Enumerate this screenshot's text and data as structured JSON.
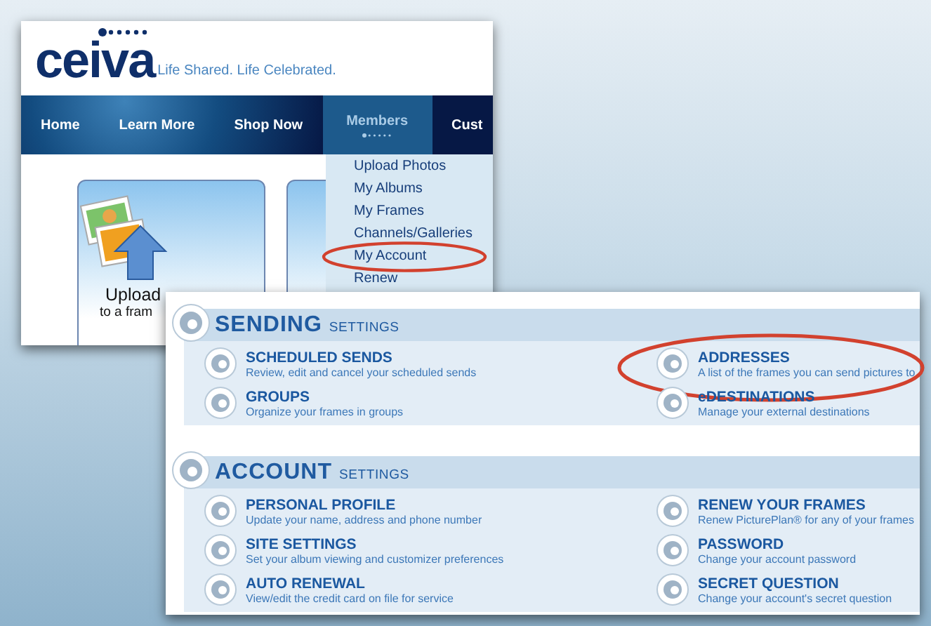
{
  "site": {
    "logo": "ceiva",
    "tagline": "Life Shared.  Life Celebrated."
  },
  "nav": [
    {
      "label": "Home",
      "selected": false
    },
    {
      "label": "Learn More",
      "selected": false
    },
    {
      "label": "Shop Now",
      "selected": false
    },
    {
      "label": "Members",
      "selected": true
    },
    {
      "label": "Cust",
      "selected": false
    }
  ],
  "dropdown": [
    {
      "label": "Upload Photos",
      "circled": false
    },
    {
      "label": "My Albums",
      "circled": false
    },
    {
      "label": "My Frames",
      "circled": false
    },
    {
      "label": "Channels/Galleries",
      "circled": false
    },
    {
      "label": "My Account",
      "circled": true
    },
    {
      "label": "Renew",
      "circled": false
    }
  ],
  "card": {
    "title": "Upload",
    "subtitle": "to a fram"
  },
  "sections": [
    {
      "title": "SENDING",
      "suffix": "SETTINGS",
      "items": [
        {
          "title": "SCHEDULED SENDS",
          "description": "Review, edit and cancel your scheduled sends",
          "circled": false
        },
        {
          "title": "ADDRESSES",
          "description": "A list of the frames you can send pictures to",
          "circled": true
        },
        {
          "title": "GROUPS",
          "description": "Organize your frames in groups",
          "circled": false
        },
        {
          "title": "eDESTINATIONS",
          "description": "Manage your external destinations",
          "circled": false
        }
      ]
    },
    {
      "title": "ACCOUNT",
      "suffix": "SETTINGS",
      "items": [
        {
          "title": "PERSONAL PROFILE",
          "description": "Update your name, address and phone number",
          "circled": false
        },
        {
          "title": "RENEW YOUR FRAMES",
          "description": "Renew PicturePlan® for any of your frames",
          "circled": false
        },
        {
          "title": "SITE SETTINGS",
          "description": "Set your album viewing and customizer preferences",
          "circled": false
        },
        {
          "title": "PASSWORD",
          "description": "Change your account password",
          "circled": false
        },
        {
          "title": "AUTO RENEWAL",
          "description": "View/edit the credit card on file for service",
          "circled": false
        },
        {
          "title": "SECRET QUESTION",
          "description": "Change your account's secret question",
          "circled": false
        }
      ]
    }
  ]
}
